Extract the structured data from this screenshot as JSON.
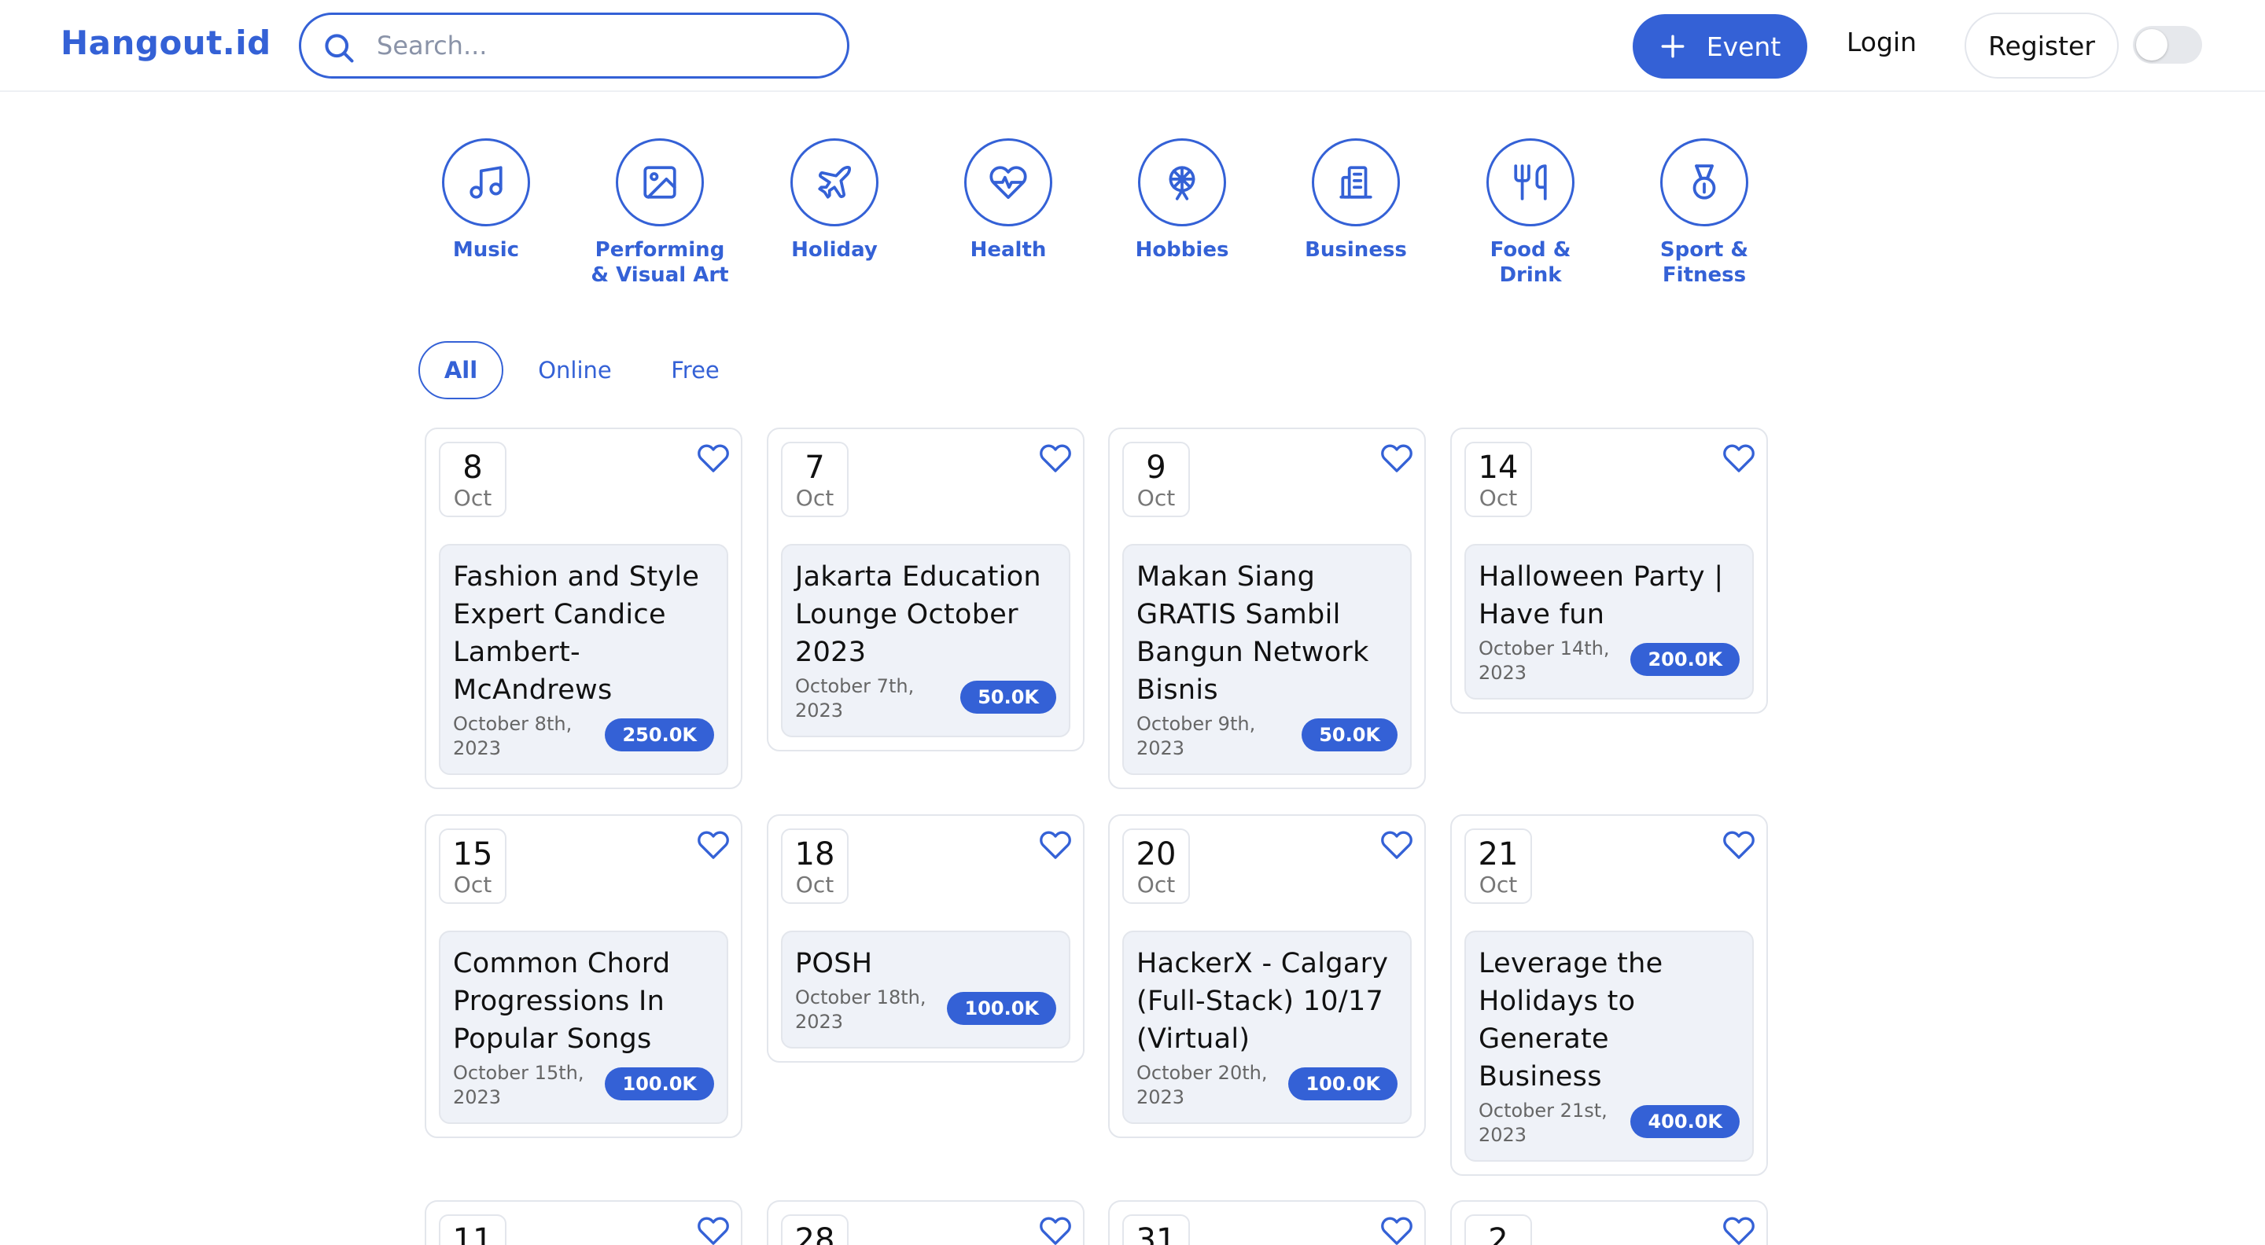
{
  "header": {
    "logo": "Hangout.id",
    "search_placeholder": "Search...",
    "event_button": "Event",
    "login": "Login",
    "register": "Register"
  },
  "categories": [
    {
      "label": "Music",
      "icon": "music-note-icon"
    },
    {
      "label": "Performing & Visual Art",
      "icon": "image-icon"
    },
    {
      "label": "Holiday",
      "icon": "airplane-icon"
    },
    {
      "label": "Health",
      "icon": "heart-pulse-icon"
    },
    {
      "label": "Hobbies",
      "icon": "ferris-wheel-icon"
    },
    {
      "label": "Business",
      "icon": "building-icon"
    },
    {
      "label": "Food & Drink",
      "icon": "fork-knife-icon"
    },
    {
      "label": "Sport & Fitness",
      "icon": "medal-icon"
    }
  ],
  "filters": {
    "active": "All",
    "tabs": [
      "All",
      "Online",
      "Free"
    ]
  },
  "events": [
    {
      "day": "8",
      "month": "Oct",
      "title": "Fashion and Style Expert Candice Lambert-McAndrews",
      "date": "October 8th, 2023",
      "price": "250.0K"
    },
    {
      "day": "7",
      "month": "Oct",
      "title": "Jakarta Education Lounge October 2023",
      "date": "October 7th, 2023",
      "price": "50.0K"
    },
    {
      "day": "9",
      "month": "Oct",
      "title": "Makan Siang GRATIS Sambil Bangun Network Bisnis",
      "date": "October 9th, 2023",
      "price": "50.0K"
    },
    {
      "day": "14",
      "month": "Oct",
      "title": "Halloween Party | Have fun",
      "date": "October 14th, 2023",
      "price": "200.0K"
    },
    {
      "day": "15",
      "month": "Oct",
      "title": "Common Chord Progressions In Popular Songs",
      "date": "October 15th, 2023",
      "price": "100.0K"
    },
    {
      "day": "18",
      "month": "Oct",
      "title": "POSH",
      "date": "October 18th, 2023",
      "price": "100.0K"
    },
    {
      "day": "20",
      "month": "Oct",
      "title": "HackerX - Calgary (Full-Stack) 10/17 (Virtual)",
      "date": "October 20th, 2023",
      "price": "100.0K"
    },
    {
      "day": "21",
      "month": "Oct",
      "title": "Leverage the Holidays to Generate Business",
      "date": "October 21st, 2023",
      "price": "400.0K"
    },
    {
      "day": "11"
    },
    {
      "day": "28"
    },
    {
      "day": "31"
    },
    {
      "day": "2"
    }
  ],
  "colors": {
    "accent": "#3461d6",
    "card_body": "#eff2f8",
    "border": "#e3e6ec"
  }
}
